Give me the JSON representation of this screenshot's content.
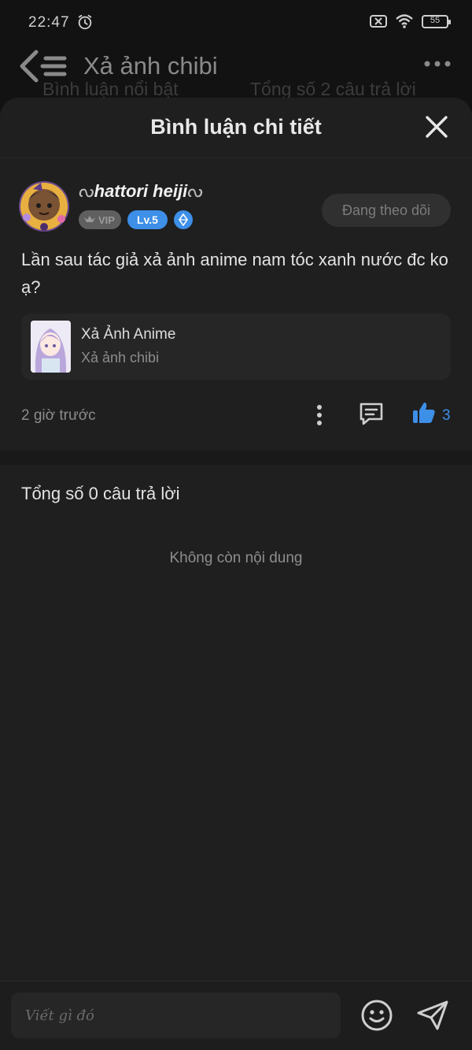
{
  "status_bar": {
    "time": "22:47",
    "battery": "55"
  },
  "background_page": {
    "title": "Xả ảnh chibi",
    "sub_left": "Bình luận nổi bật",
    "sub_right": "Tổng số 2 câu trả lời"
  },
  "sheet": {
    "title": "Bình luận chi tiết",
    "user": {
      "name": "hattori heiji",
      "vip_label": "VIP",
      "level": "Lv.5",
      "follow_label": "Đang theo dõi"
    },
    "comment_text": "Lần sau tác giả xả ảnh anime nam tóc xanh nước đc ko ạ?",
    "reference": {
      "title": "Xả Ảnh Anime",
      "subtitle": "Xả ảnh chibi"
    },
    "time_ago": "2 giờ trước",
    "like_count": "3",
    "replies_title": "Tổng số 0 câu trả lời",
    "empty_text": "Không còn nội dung"
  },
  "composer": {
    "placeholder": "Viết gì đó"
  },
  "colors": {
    "accent": "#3d8fe8",
    "sheet_bg": "#1f1f1f"
  },
  "icons": [
    "alarm-icon",
    "sim-off-icon",
    "wifi-icon",
    "battery-icon",
    "back-icon",
    "more-horizontal-icon",
    "close-icon",
    "crown-icon",
    "gem-icon",
    "more-vertical-icon",
    "reply-icon",
    "thumbs-up-icon",
    "emoji-icon",
    "send-icon"
  ]
}
